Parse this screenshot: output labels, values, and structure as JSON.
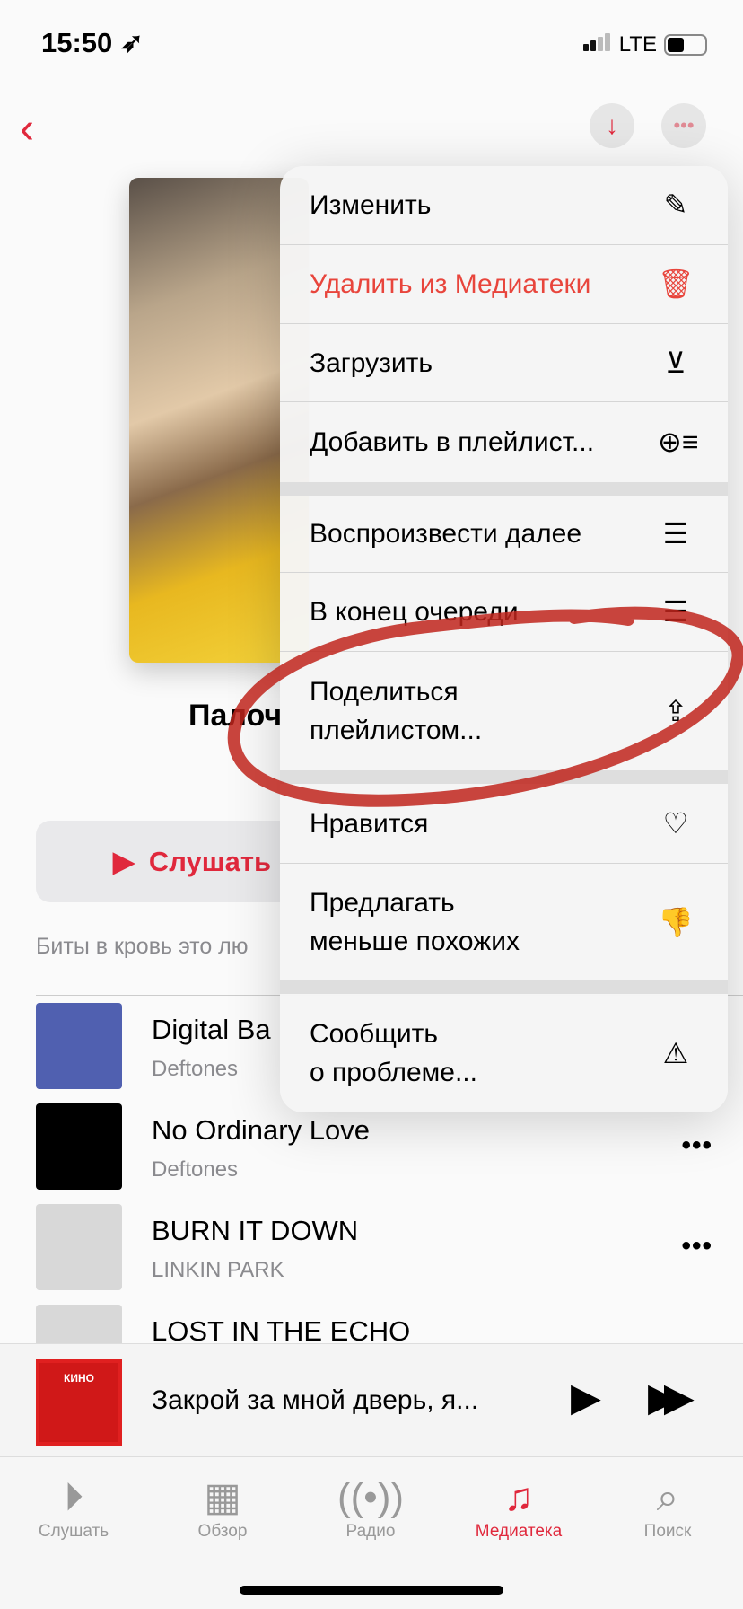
{
  "status": {
    "time": "15:50",
    "network": "LTE"
  },
  "nav": {
    "back_icon": "chevron-left-icon",
    "download_icon": "arrow-down-icon",
    "more_icon": "ellipsis-icon"
  },
  "playlist": {
    "title": "Палоч",
    "listen_label": "Слушать",
    "description": "Биты в кровь это лю"
  },
  "songs": [
    {
      "title": "Digital Ba",
      "artist": "Deftones"
    },
    {
      "title": "No Ordinary Love",
      "artist": "Deftones"
    },
    {
      "title": "BURN IT DOWN",
      "artist": "LINKIN PARK"
    },
    {
      "title": "LOST IN THE ECHO",
      "artist": ""
    }
  ],
  "mini_player": {
    "title": "Закрой за мной дверь, я...",
    "art_text": "КИНО"
  },
  "tabs": [
    {
      "label": "Слушать",
      "icon": "play-circle-icon"
    },
    {
      "label": "Обзор",
      "icon": "grid-icon"
    },
    {
      "label": "Радио",
      "icon": "radio-icon"
    },
    {
      "label": "Медиатека",
      "icon": "library-icon",
      "active": true
    },
    {
      "label": "Поиск",
      "icon": "search-icon"
    }
  ],
  "menu": {
    "items": [
      {
        "label": "Изменить",
        "icon": "pencil-icon"
      },
      {
        "label": "Удалить из Медиатеки",
        "icon": "trash-icon",
        "destructive": true
      },
      {
        "label": "Загрузить",
        "icon": "download-circle-icon"
      },
      {
        "label": "Добавить в плейлист...",
        "icon": "add-to-playlist-icon"
      },
      {
        "label": "Воспроизвести далее",
        "icon": "play-next-icon"
      },
      {
        "label": "В конец очереди",
        "icon": "play-last-icon"
      },
      {
        "label": "Поделиться\nплейлистом...",
        "icon": "share-icon"
      },
      {
        "label": "Нравится",
        "icon": "heart-icon"
      },
      {
        "label": "Предлагать\nменьше похожих",
        "icon": "thumbs-down-icon"
      },
      {
        "label": "Сообщить\nо проблеме...",
        "icon": "report-icon"
      }
    ]
  },
  "colors": {
    "accent": "#e0283c",
    "annotation": "#c0251c"
  }
}
